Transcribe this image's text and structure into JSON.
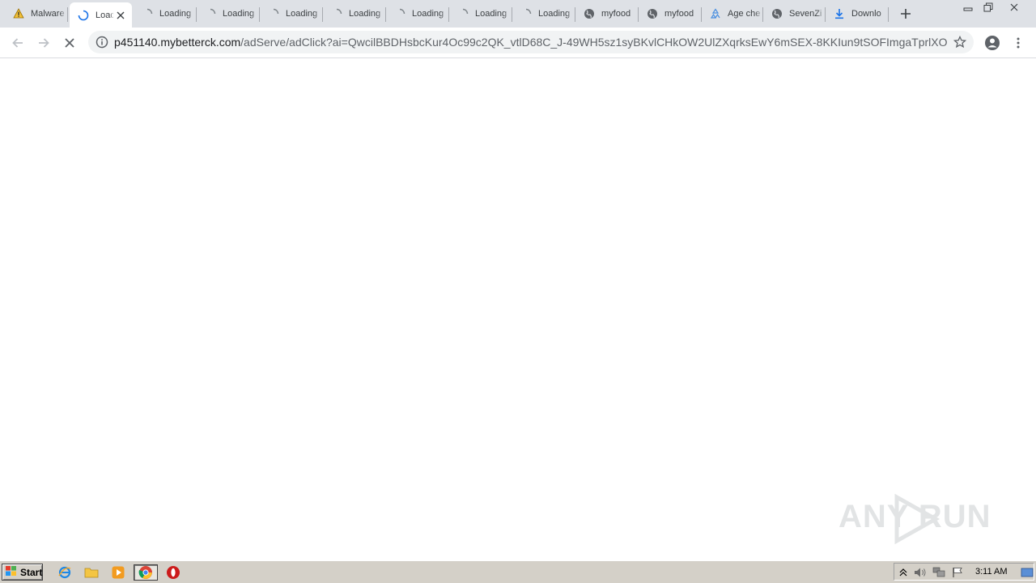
{
  "browser": {
    "tabs": [
      {
        "title": "Malware",
        "icon": "warning-icon",
        "active": false
      },
      {
        "title": "Loading",
        "icon": "spinner-icon",
        "active": true
      },
      {
        "title": "Loading",
        "icon": "spinner-icon",
        "active": false
      },
      {
        "title": "Loading",
        "icon": "spinner-icon",
        "active": false
      },
      {
        "title": "Loading",
        "icon": "spinner-icon",
        "active": false
      },
      {
        "title": "Loading",
        "icon": "spinner-icon",
        "active": false
      },
      {
        "title": "Loading",
        "icon": "spinner-icon",
        "active": false
      },
      {
        "title": "Loading",
        "icon": "spinner-icon",
        "active": false
      },
      {
        "title": "Loading",
        "icon": "spinner-icon",
        "active": false
      },
      {
        "title": "myfood",
        "icon": "globe-icon",
        "active": false
      },
      {
        "title": "myfood",
        "icon": "globe-icon",
        "active": false
      },
      {
        "title": "Age che",
        "icon": "recycle-icon",
        "active": false
      },
      {
        "title": "SevenZi",
        "icon": "globe-icon",
        "active": false
      },
      {
        "title": "Downlo",
        "icon": "download-icon",
        "active": false
      }
    ],
    "address": {
      "host": "p451140.mybetterck.com",
      "path": "/adServe/adClick?ai=QwcilBBDHsbcKur4Oc99c2QK_vtlD68C_J-49WH5sz1syBKvlCHkOW2UlZXqrksEwY6mSEX-8KKIun9tSOFImgaTprlXOMa..."
    }
  },
  "watermark": {
    "text": "ANY RUN"
  },
  "taskbar": {
    "start_label": "Start",
    "quicklaunch": [
      "ie-icon",
      "explorer-folder-icon",
      "media-player-icon",
      "chrome-icon",
      "opera-icon"
    ],
    "clock": "3:11 AM"
  },
  "colors": {
    "tabstrip": "#dee1e6",
    "active_tab": "#ffffff",
    "omnibox": "#f1f3f4",
    "taskbar": "#d4d0c8",
    "spinner": "#1a73e8"
  }
}
